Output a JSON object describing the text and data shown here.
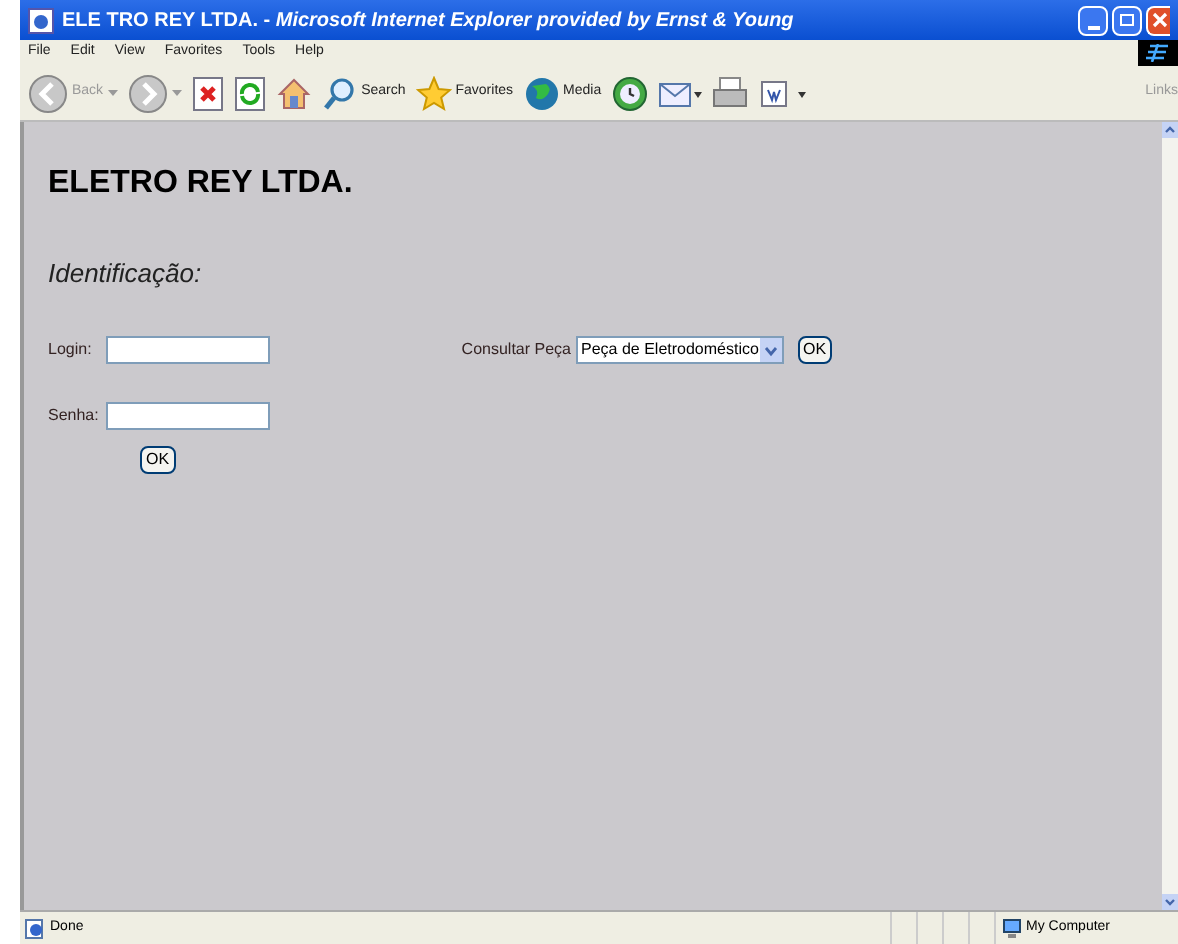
{
  "window": {
    "title": "ELE TRO REY LTDA. - *Microsoft Internet Explorer provided by Ernst & Young*"
  },
  "menu": [
    "File",
    "Edit",
    "View",
    "Favorites",
    "Tools",
    "Help"
  ],
  "toolbar": [
    {
      "kind": "back",
      "label": "Back",
      "disabled": true
    },
    {
      "kind": "forward",
      "disabled": true
    },
    {
      "kind": "stop"
    },
    {
      "kind": "refresh"
    },
    {
      "kind": "home"
    },
    {
      "kind": "search",
      "label": "Search"
    },
    {
      "kind": "favorites",
      "label": "Favorites"
    },
    {
      "kind": "media",
      "label": "Media"
    },
    {
      "kind": "history"
    },
    {
      "kind": "mail"
    },
    {
      "kind": "print"
    },
    {
      "kind": "edit"
    }
  ],
  "links_label": "Links",
  "page": {
    "heading": "ELETRO REY LTDA.",
    "subheading": "Identificação:",
    "login": {
      "label": "Login:"
    },
    "password": {
      "label": "Senha:"
    },
    "login_button": "OK",
    "query": {
      "label": "Consultar Peça",
      "value": "Peça de Eletrodoméstico",
      "button": "OK"
    }
  },
  "status_bar": {
    "text": "Done",
    "zone": "My Computer"
  }
}
